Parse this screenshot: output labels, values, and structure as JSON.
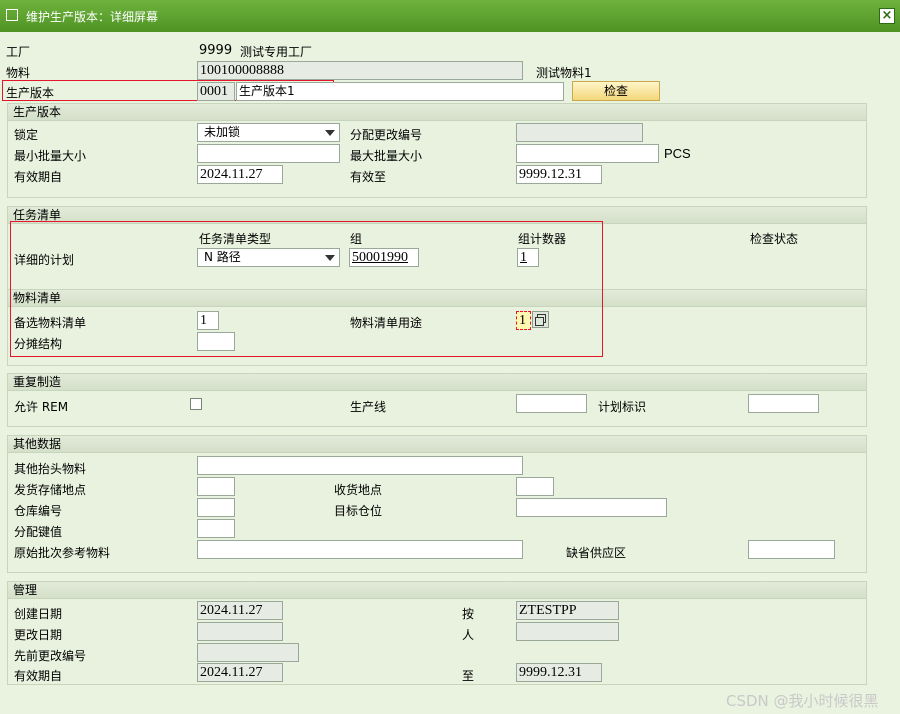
{
  "window": {
    "title": "维护生产版本：详细屏幕",
    "icon": "edit-icon",
    "close": "close-icon"
  },
  "header": {
    "plant_label": "工厂",
    "plant_value": "9999",
    "plant_name": "测试专用工厂",
    "material_label": "物料",
    "material_value": "100100008888",
    "material_name": "测试物料1",
    "version_label": "生产版本",
    "version_value": "0001",
    "version_text": "生产版本1",
    "check_button": "检查"
  },
  "prod_version": {
    "title": "生产版本",
    "lock_label": "锁定",
    "lock_value": "未加锁",
    "change_no_label": "分配更改编号",
    "change_no_value": "",
    "min_lot_label": "最小批量大小",
    "min_lot_value": "",
    "max_lot_label": "最大批量大小",
    "max_lot_value": "",
    "unit": "PCS",
    "valid_from_label": "有效期自",
    "valid_from_value": "2024.11.27",
    "valid_to_label": "有效至",
    "valid_to_value": "9999.12.31"
  },
  "task_list": {
    "title": "任务清单",
    "col_type": "任务清单类型",
    "col_group": "组",
    "col_counter": "组计数器",
    "col_status": "检查状态",
    "row_label": "详细的计划",
    "type_value": "N 路径",
    "group_value": "50001990",
    "counter_value": "1"
  },
  "bom": {
    "title": "物料清单",
    "alt_label": "备选物料清单",
    "alt_value": "1",
    "usage_label": "物料清单用途",
    "usage_value": "1",
    "apportion_label": "分摊结构",
    "apportion_value": ""
  },
  "rem": {
    "title": "重复制造",
    "allow_label": "允许 REM",
    "line_label": "生产线",
    "line_value": "",
    "plan_id_label": "计划标识",
    "plan_id_value": ""
  },
  "other": {
    "title": "其他数据",
    "header_mat_label": "其他抬头物料",
    "header_mat_value": "",
    "issue_sloc_label": "发货存储地点",
    "issue_sloc_value": "",
    "receipt_loc_label": "收货地点",
    "receipt_loc_value": "",
    "wh_label": "仓库编号",
    "wh_value": "",
    "dest_bin_label": "目标仓位",
    "dest_bin_value": "",
    "key_label": "分配键值",
    "key_value": "",
    "orig_batch_label": "原始批次参考物料",
    "orig_batch_value": "",
    "supply_area_label": "缺省供应区",
    "supply_area_value": ""
  },
  "admin": {
    "title": "管理",
    "created_label": "创建日期",
    "created_value": "2024.11.27",
    "by_label": "按",
    "by_value": "ZTESTPP",
    "changed_label": "更改日期",
    "changed_value": "",
    "person_label": "人",
    "person_value": "",
    "prev_change_label": "先前更改编号",
    "prev_change_value": "",
    "valid_from_label": "有效期自",
    "valid_from_value": "2024.11.27",
    "to_label": "至",
    "to_value": "9999.12.31"
  },
  "watermark": "CSDN @我小时候很黑",
  "colors": {
    "titlebar": "#5ea12e",
    "highlight_box": "#e3162a",
    "button": "#f3d77b"
  }
}
